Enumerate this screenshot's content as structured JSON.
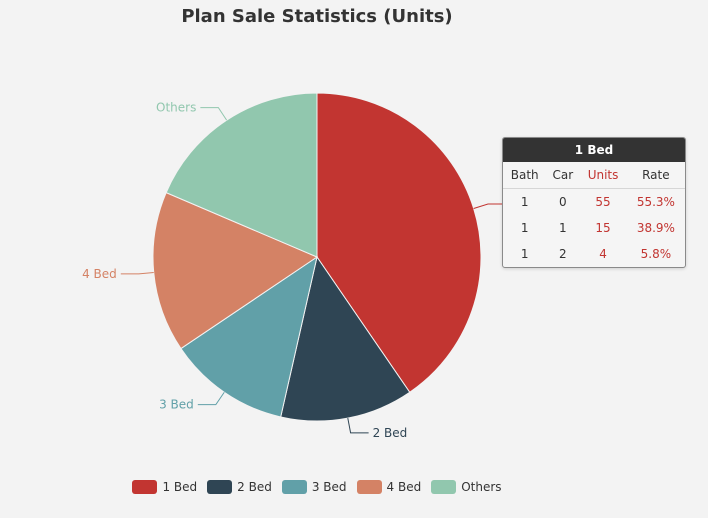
{
  "chart_data": {
    "type": "pie",
    "title": "Plan Sale Statistics (Units)",
    "slices": [
      {
        "name": "1 Bed",
        "value": 74,
        "color": "#c23531"
      },
      {
        "name": "2 Bed",
        "value": 24,
        "color": "#2f4554"
      },
      {
        "name": "3 Bed",
        "value": 22,
        "color": "#61a0a8"
      },
      {
        "name": "4 Bed",
        "value": 29,
        "color": "#d48265"
      },
      {
        "name": "Others",
        "value": 34,
        "color": "#91c7ae"
      }
    ],
    "legend": {
      "position": "bottom"
    }
  },
  "tooltip": {
    "title": "1 Bed",
    "columns": [
      "Bath",
      "Car",
      "Units",
      "Rate"
    ],
    "rows": [
      [
        "1",
        "0",
        "55",
        "55.3%"
      ],
      [
        "1",
        "1",
        "15",
        "38.9%"
      ],
      [
        "1",
        "2",
        "4",
        "5.8%"
      ]
    ]
  }
}
